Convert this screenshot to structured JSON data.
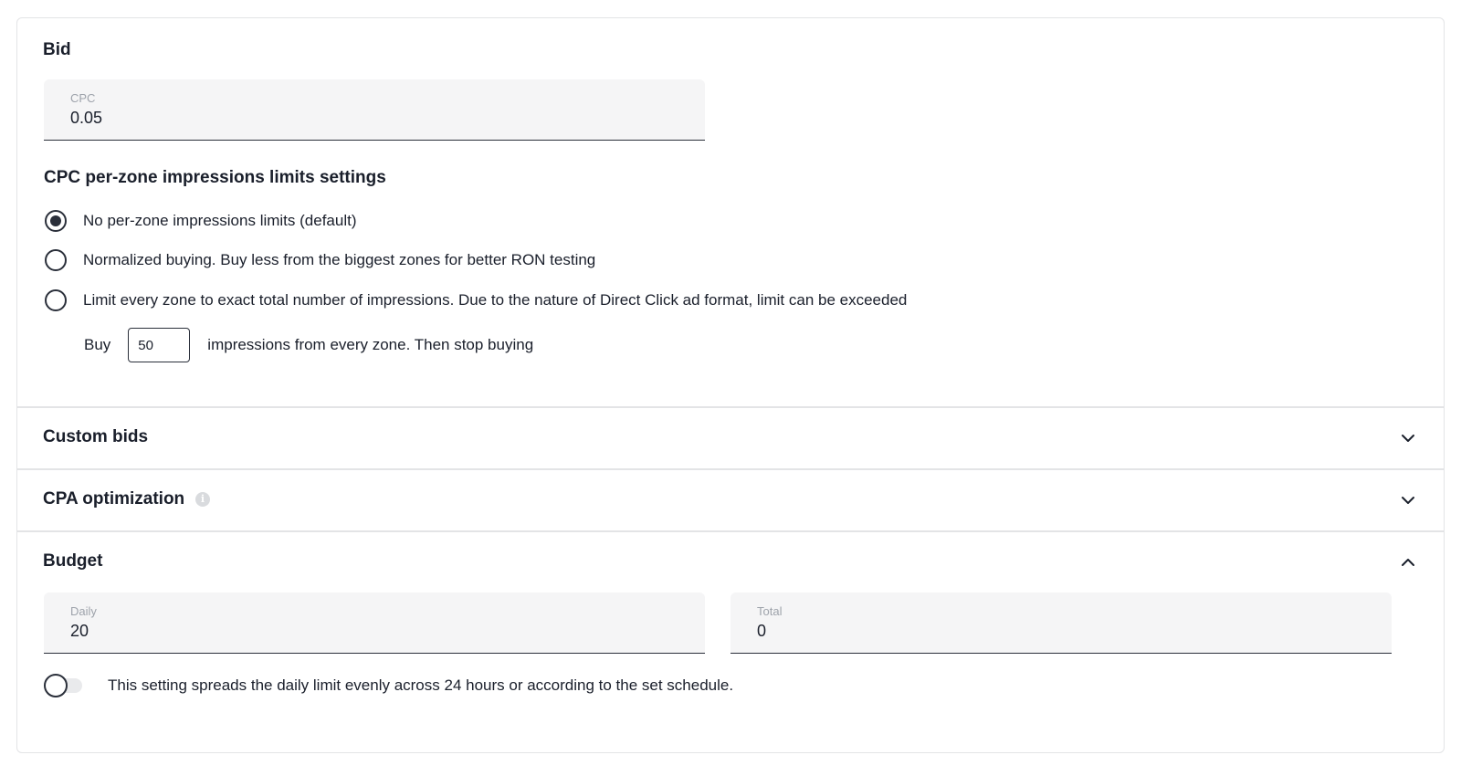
{
  "bid": {
    "title": "Bid",
    "cpc": {
      "label": "CPC",
      "value": "0.05"
    }
  },
  "limits": {
    "title": "CPC per-zone impressions limits settings",
    "options": [
      {
        "label": "No per-zone impressions limits (default)",
        "checked": true
      },
      {
        "label": "Normalized buying. Buy less from the biggest zones for better RON testing",
        "checked": false
      },
      {
        "label": "Limit every zone to exact total number of impressions. Due to the nature of Direct Click ad format, limit can be exceeded",
        "checked": false
      }
    ],
    "buy": {
      "prefix": "Buy",
      "value": "50",
      "suffix": "impressions from every zone. Then stop buying"
    }
  },
  "sections": {
    "custom_bids": {
      "title": "Custom bids",
      "icon": "chevron-down-icon",
      "expanded": false
    },
    "cpa_optimization": {
      "title": "CPA optimization",
      "info_icon": "info-icon",
      "icon": "chevron-down-icon",
      "expanded": false
    },
    "budget": {
      "title": "Budget",
      "icon": "chevron-up-icon",
      "expanded": true
    }
  },
  "budget": {
    "daily": {
      "label": "Daily",
      "value": "20"
    },
    "total": {
      "label": "Total",
      "value": "0"
    },
    "spread_toggle": {
      "label": "This setting spreads the daily limit evenly across 24 hours or according to the set schedule.",
      "on": false
    }
  }
}
